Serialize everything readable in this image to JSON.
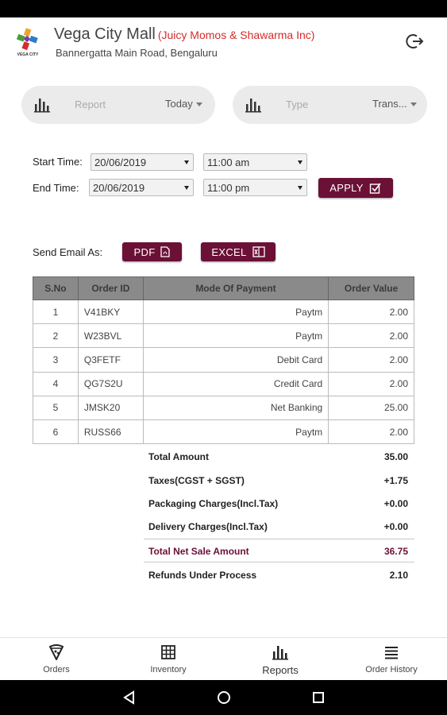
{
  "header": {
    "logo_caption": "VEGA CITY",
    "mall_name": "Vega City Mall",
    "store_name": "(Juicy Momos & Shawarma Inc)",
    "address": "Bannergatta Main Road, Bengaluru",
    "logout_icon": "logout-icon"
  },
  "filters": {
    "report": {
      "label": "Report",
      "value": "Today",
      "icon": "bar-chart-icon"
    },
    "type": {
      "label": "Type",
      "value": "Trans...",
      "icon": "bar-chart-icon"
    }
  },
  "time": {
    "start_label": "Start Time:",
    "end_label": "End Time:",
    "start_date": "20/06/2019",
    "start_time": "11:00 am",
    "end_date": "20/06/2019",
    "end_time": "11:00 pm",
    "apply_label": "APPLY"
  },
  "email": {
    "label": "Send Email As:",
    "pdf_label": "PDF",
    "excel_label": "EXCEL"
  },
  "table": {
    "headers": [
      "S.No",
      "Order ID",
      "Mode Of Payment",
      "Order Value"
    ],
    "rows": [
      [
        "1",
        "V41BKY",
        "Paytm",
        "2.00"
      ],
      [
        "2",
        "W23BVL",
        "Paytm",
        "2.00"
      ],
      [
        "3",
        "Q3FETF",
        "Debit Card",
        "2.00"
      ],
      [
        "4",
        "QG7S2U",
        "Credit Card",
        "2.00"
      ],
      [
        "5",
        "JMSK20",
        "Net Banking",
        "25.00"
      ],
      [
        "6",
        "RUSS66",
        "Paytm",
        "2.00"
      ]
    ]
  },
  "summary": [
    {
      "label": "Total Amount",
      "value": "35.00"
    },
    {
      "label": "Taxes(CGST + SGST)",
      "value": "+1.75"
    },
    {
      "label": "Packaging Charges(Incl.Tax)",
      "value": "+0.00"
    },
    {
      "label": "Delivery Charges(Incl.Tax)",
      "value": "+0.00"
    },
    {
      "label": "Total Net Sale Amount",
      "value": "36.75"
    },
    {
      "label": "Refunds Under Process",
      "value": "2.10"
    }
  ],
  "nav": {
    "orders": "Orders",
    "inventory": "Inventory",
    "reports": "Reports",
    "history": "Order History",
    "active": "Reports"
  },
  "colors": {
    "accent": "#6b1036",
    "store_name": "#d42c2c",
    "table_header": "#8a8a8a"
  }
}
